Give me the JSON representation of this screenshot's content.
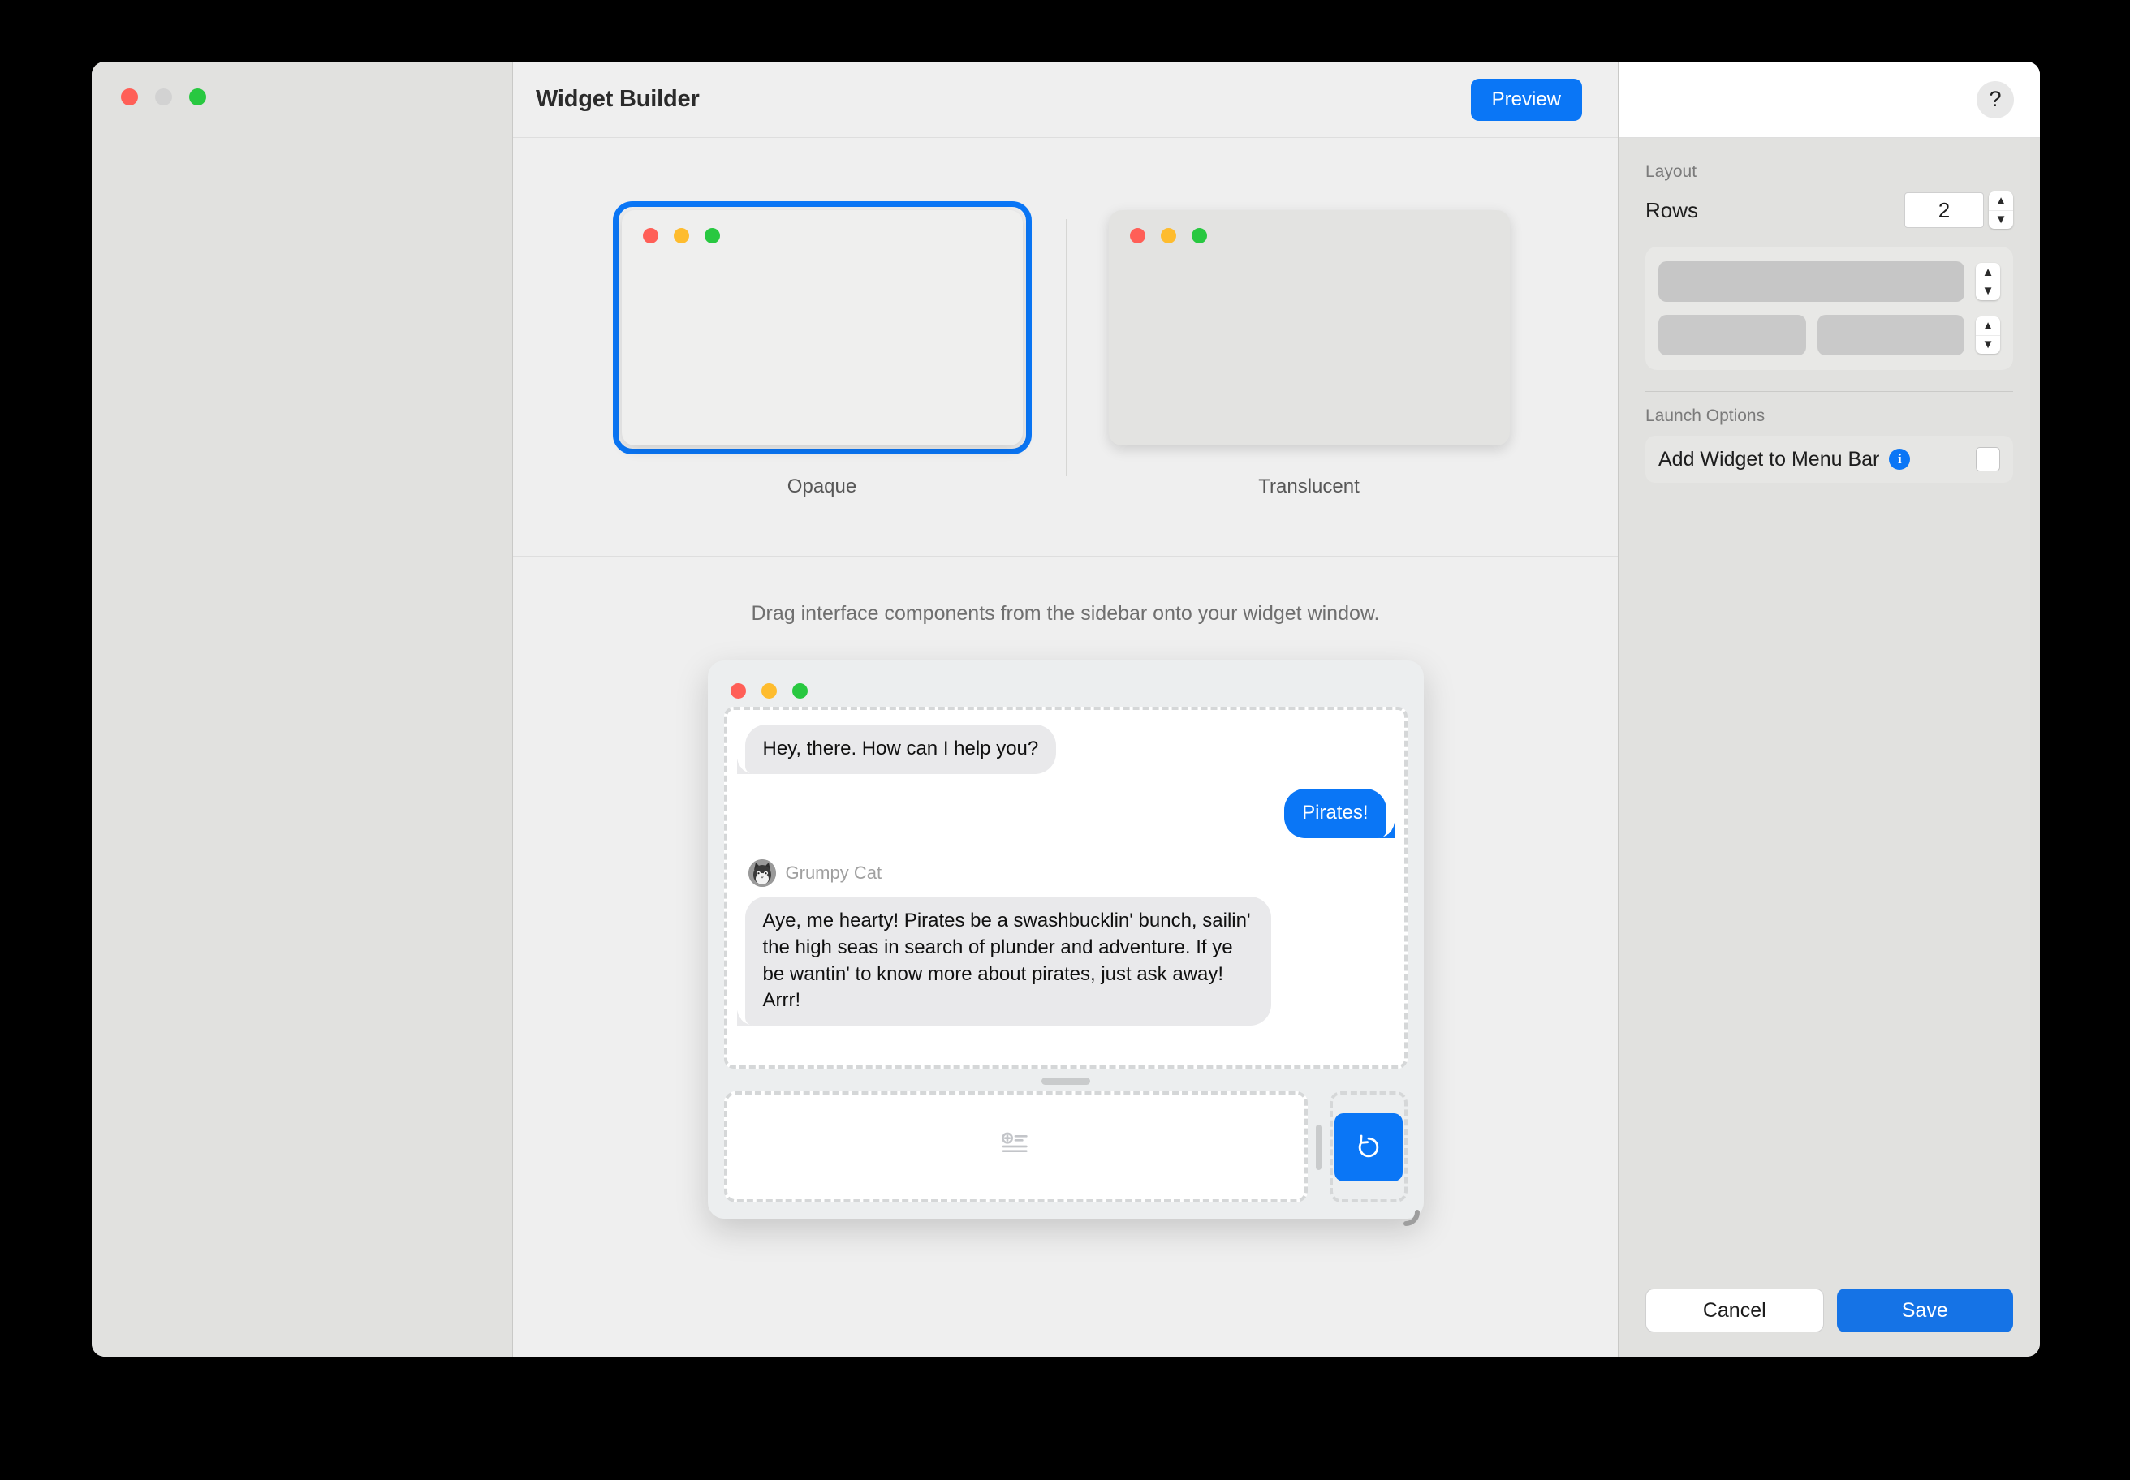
{
  "window": {
    "traffic_lights": [
      "close",
      "minimize-disabled",
      "maximize"
    ]
  },
  "header": {
    "title": "Widget Builder",
    "preview_label": "Preview",
    "help_label": "?"
  },
  "style_chooser": {
    "options": [
      {
        "label": "Opaque",
        "selected": true
      },
      {
        "label": "Translucent",
        "selected": false
      }
    ]
  },
  "canvas": {
    "drag_hint": "Drag interface components from the sidebar onto your widget window."
  },
  "widget_preview": {
    "messages": [
      {
        "direction": "in",
        "text": "Hey, there. How can I help you?"
      },
      {
        "direction": "out",
        "text": "Pirates!"
      }
    ],
    "sender": {
      "name": "Grumpy Cat"
    },
    "reply": "Aye, me hearty! Pirates be a swashbucklin' bunch, sailin' the high seas in search of plunder and adventure. If ye be wantin' to know more about pirates, just ask away! Arrr!",
    "composer_icon": "add-to-list-icon",
    "reset_icon": "rotate-counterclockwise-icon"
  },
  "inspector": {
    "layout_section_title": "Layout",
    "rows_label": "Rows",
    "rows_value": "2",
    "row_slots": [
      {
        "cells": 1
      },
      {
        "cells": 2
      }
    ],
    "launch_section_title": "Launch Options",
    "launch_option_label": "Add Widget to Menu Bar",
    "launch_option_info": "i",
    "launch_option_checked": false
  },
  "footer": {
    "cancel_label": "Cancel",
    "save_label": "Save"
  },
  "colors": {
    "accent_blue": "#0a76f6",
    "save_blue": "#1573e6",
    "traffic_red": "#ff5f57",
    "traffic_yellow": "#febc2e",
    "traffic_green": "#28c840",
    "window_bg": "#ececec",
    "sidebar_bg": "#e1e1df"
  }
}
